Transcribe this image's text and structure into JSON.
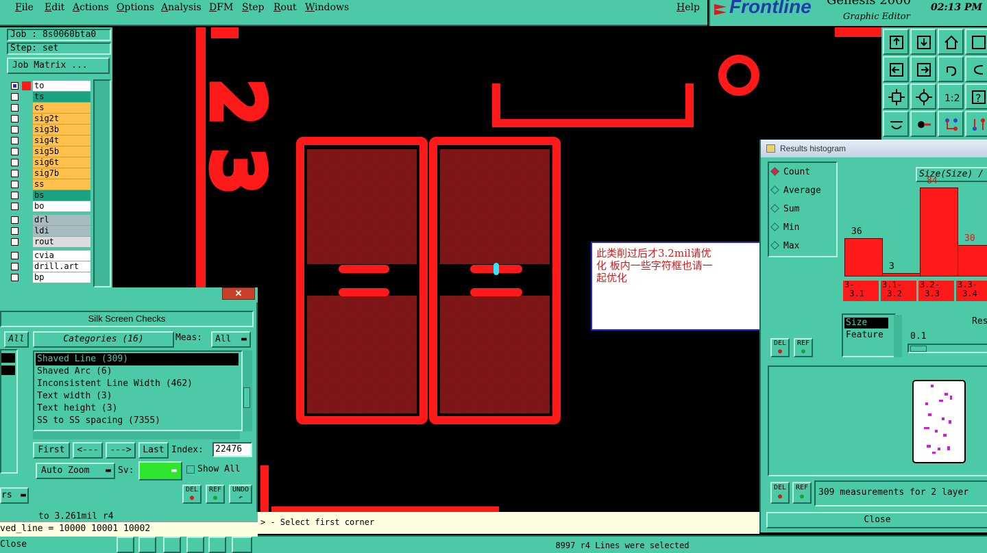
{
  "menu": {
    "items": [
      "File",
      "Edit",
      "Actions",
      "Options",
      "Analysis",
      "DFM",
      "Step",
      "Rout",
      "Windows"
    ],
    "help": "Help"
  },
  "brand": {
    "logo": "Frontline",
    "product": "Genesis 2000",
    "subtitle": "Graphic Editor",
    "time": "02:13 PM"
  },
  "job": {
    "job_label": "Job : 8s0060bta0",
    "step_label": "Step: set",
    "matrix_button": "Job Matrix ..."
  },
  "layers": [
    {
      "name": "to",
      "color": "#ffffff",
      "active": true
    },
    {
      "name": "ts",
      "color": "#1aa382"
    },
    {
      "name": "cs",
      "color": "#ffc04c"
    },
    {
      "name": "sig2t",
      "color": "#ffc04c"
    },
    {
      "name": "sig3b",
      "color": "#ffc04c"
    },
    {
      "name": "sig4t",
      "color": "#ffc04c"
    },
    {
      "name": "sig5b",
      "color": "#ffc04c"
    },
    {
      "name": "sig6t",
      "color": "#ffc04c"
    },
    {
      "name": "sig7b",
      "color": "#ffc04c"
    },
    {
      "name": "ss",
      "color": "#ffc04c"
    },
    {
      "name": "bs",
      "color": "#1aa382"
    },
    {
      "name": "bo",
      "color": "#ffffff"
    },
    {
      "name": "drl",
      "color": "#a8bcc0"
    },
    {
      "name": "ldi",
      "color": "#a8bcc0"
    },
    {
      "name": "rout",
      "color": "#dcdcdc"
    },
    {
      "name": "cvia",
      "color": "#ffffff"
    },
    {
      "name": "drill.art",
      "color": "#ffffff"
    },
    {
      "name": "bp",
      "color": "#ffffff"
    }
  ],
  "canvas": {
    "silk_digits": [
      "2",
      "3"
    ],
    "silk_letter": "o"
  },
  "annotation": {
    "line1": "此类削过后才3.2mil请优",
    "line2": "化  板内一些字符框也请一",
    "line3": "起优化"
  },
  "histogram": {
    "window_title": "Results histogram",
    "options": [
      "Count",
      "Average",
      "Sum",
      "Min",
      "Max"
    ],
    "selected_option": "Count",
    "dropdown": "Size(Size) /",
    "bars": [
      {
        "label": "3-\n 3.1",
        "value": 36
      },
      {
        "label": "3.1-\n 3.2",
        "value": 3
      },
      {
        "label": "3.2-\n 3.3",
        "value": 84
      },
      {
        "label": "3.3-\n 3.4",
        "value": 30
      }
    ],
    "attr_list": [
      "Size",
      "Feature"
    ],
    "res_label": "Res",
    "res_value": "0.1",
    "del_label": "DEL",
    "ref_label": "REF",
    "status": "309 measurements for 2 layer",
    "close": "Close"
  },
  "silk": {
    "title": "Silk Screen Checks",
    "all_btn": "All",
    "categories_btn": "Categories (16)",
    "meas_label": "Meas:",
    "meas_value": "All",
    "categories": [
      "Shaved Line (309)",
      "Shaved Arc (6)",
      "Inconsistent Line Width (462)",
      "Text width (3)",
      "Text height (3)",
      "SS to SS spacing (7355)"
    ],
    "first": "First",
    "prev": "<---",
    "next": "--->",
    "last": "Last",
    "index_label": "Index:",
    "index_value": "22476",
    "zoom": "Auto Zoom",
    "sv_label": "Sv:",
    "show_all": "Show All",
    "del": "DEL",
    "ref": "REF",
    "undo": "UNDO",
    "left_dropdown": "rs"
  },
  "bottom": {
    "line1": "to 3.261mil  r4",
    "line2": "ved_line = 10000 10001 10002",
    "close": "Close",
    "prompt": "> - Select first corner",
    "status": "8997 r4 Lines were selected"
  }
}
